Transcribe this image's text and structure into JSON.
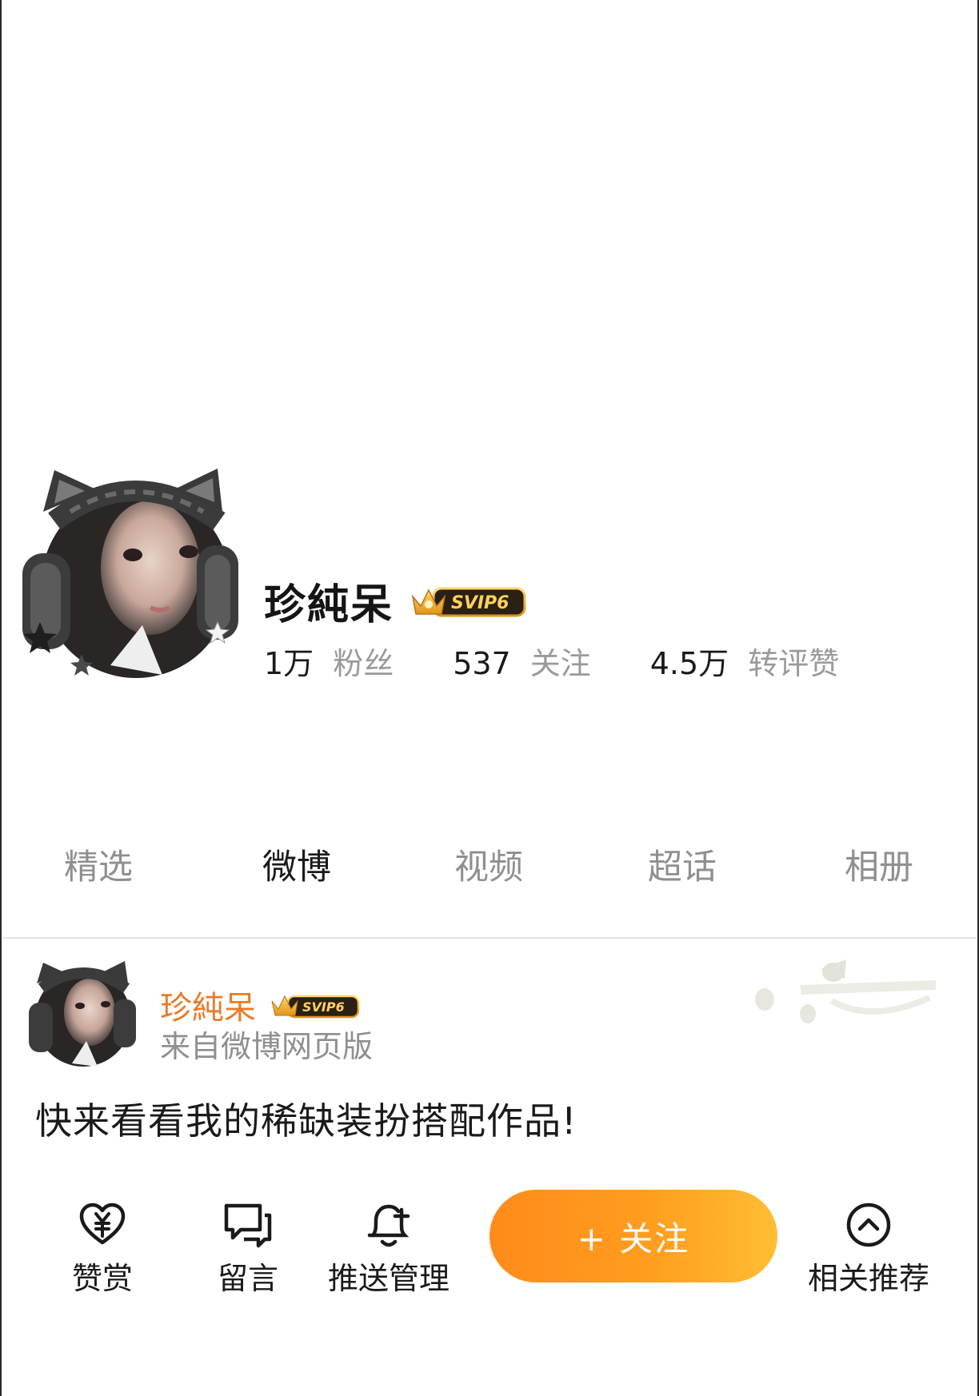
{
  "profile": {
    "name": "珍純呆",
    "vip_badge": "SVIP6",
    "stats": [
      {
        "value": "1万",
        "label": "粉丝"
      },
      {
        "value": "537",
        "label": "关注"
      },
      {
        "value": "4.5万",
        "label": "转评赞"
      }
    ]
  },
  "tabs": [
    {
      "label": "精选"
    },
    {
      "label": "微博"
    },
    {
      "label": "视频"
    },
    {
      "label": "超话"
    },
    {
      "label": "相册"
    }
  ],
  "post": {
    "author": "珍純呆",
    "vip_badge": "SVIP6",
    "source": "来自微博网页版",
    "text": "快来看看我的稀缺装扮搭配作品!"
  },
  "bottom_bar": {
    "reward_label": "赞赏",
    "message_label": "留言",
    "push_label": "推送管理",
    "follow_label": "+ 关注",
    "recommend_label": "相关推荐"
  },
  "colors": {
    "accent": "#ff8b1a",
    "accent_end": "#ffbe34",
    "post_name": "#e87a2a",
    "muted_text": "#9a9a9a"
  },
  "icons": {
    "reward": "heart-yen-icon",
    "message": "chat-bubbles-icon",
    "push": "bell-plus-icon",
    "recommend": "chevron-up-circle-icon"
  }
}
